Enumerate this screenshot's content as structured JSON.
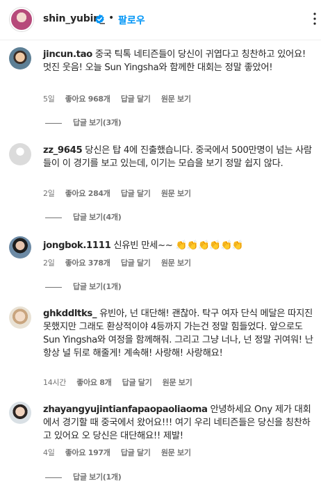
{
  "header": {
    "username": "shin_yubin_",
    "dot": "•",
    "follow_label": "팔로우"
  },
  "comments": [
    {
      "username": "jincun.tao",
      "text": "중국 틱톡 네티즌들이 당신이 귀엽다고 칭찬하고 있어요! 멋진 웃음! 오늘 Sun Yingsha와 함께한 대회는 정말 좋았어!",
      "time": "5일",
      "likes": "좋아요 968개",
      "reply_label": "답글 달기",
      "translate_label": "원문 보기",
      "view_replies": "답글 보기(3개)"
    },
    {
      "username": "zz_9645",
      "text": "당신은 탑 4에 진출했습니다. 중국에서 500만명이 넘는 사람들이 이 경기를 보고 있는데, 이기는 모습을 보기 정말 쉽지 않다.",
      "time": "2일",
      "likes": "좋아요 284개",
      "reply_label": "답글 달기",
      "translate_label": "원문 보기",
      "view_replies": "답글 보기(4개)"
    },
    {
      "username": "jongbok.1111",
      "text": "신유빈 만세~~",
      "emoji": "👏👏👏👏👏👏",
      "time": "2일",
      "likes": "좋아요 378개",
      "reply_label": "답글 달기",
      "translate_label": "원문 보기",
      "view_replies": "답글 보기(1개)"
    },
    {
      "username": "ghkddltks_",
      "text": "유빈아, 넌 대단해! 괜찮아. 탁구 여자 단식 메달은 따지진 못했지만 그래도 환상적이야 4등까지 가는건 정말 힘들었다. 앞으로도 Sun Yingsha와 여정을 함께해줘. 그리고 그냥 너나, 넌 정말 귀여워! 난 항상 널 뒤로 해줄게! 계속해! 사랑해! 사랑해요!",
      "time": "14시간",
      "likes": "좋아요 8개",
      "reply_label": "답글 달기",
      "translate_label": "원문 보기"
    },
    {
      "username": "zhayangyujintianfapaopaoliaoma",
      "text": "안녕하세요 Ony 제가 대회에서 경기할 때 중국에서 왔어요!!! 여기 우리 네티즌들은 당신을 칭찬하고 있어요 오 당신은 대단해요!! 제발!",
      "time": "4일",
      "likes": "좋아요 197개",
      "reply_label": "답글 달기",
      "translate_label": "원문 보기",
      "view_replies": "답글 보기(1개)"
    }
  ],
  "colors": {
    "accent": "#0095f6",
    "verified": "#0095f6",
    "text": "#262626",
    "muted": "#737373"
  },
  "icons": {
    "verified": "verified-badge-icon",
    "more": "more-options-icon"
  }
}
